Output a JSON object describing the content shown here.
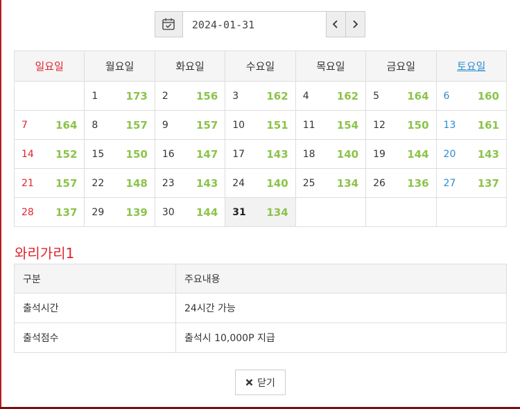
{
  "datepicker": {
    "value": "2024-01-31",
    "icon": "calendar-check-icon",
    "prev_icon": "chevron-left-icon",
    "next_icon": "chevron-right-icon"
  },
  "calendar": {
    "weekdays": [
      "일요일",
      "월요일",
      "화요일",
      "수요일",
      "목요일",
      "금요일",
      "토요일"
    ],
    "weeks": [
      [
        null,
        {
          "day": "1",
          "count": "173"
        },
        {
          "day": "2",
          "count": "156"
        },
        {
          "day": "3",
          "count": "162"
        },
        {
          "day": "4",
          "count": "162"
        },
        {
          "day": "5",
          "count": "164"
        },
        {
          "day": "6",
          "count": "160"
        }
      ],
      [
        {
          "day": "7",
          "count": "164"
        },
        {
          "day": "8",
          "count": "157"
        },
        {
          "day": "9",
          "count": "157"
        },
        {
          "day": "10",
          "count": "151"
        },
        {
          "day": "11",
          "count": "154"
        },
        {
          "day": "12",
          "count": "150"
        },
        {
          "day": "13",
          "count": "161"
        }
      ],
      [
        {
          "day": "14",
          "count": "152"
        },
        {
          "day": "15",
          "count": "150"
        },
        {
          "day": "16",
          "count": "147"
        },
        {
          "day": "17",
          "count": "143"
        },
        {
          "day": "18",
          "count": "140"
        },
        {
          "day": "19",
          "count": "144"
        },
        {
          "day": "20",
          "count": "143"
        }
      ],
      [
        {
          "day": "21",
          "count": "157"
        },
        {
          "day": "22",
          "count": "148"
        },
        {
          "day": "23",
          "count": "143"
        },
        {
          "day": "24",
          "count": "140"
        },
        {
          "day": "25",
          "count": "134"
        },
        {
          "day": "26",
          "count": "136"
        },
        {
          "day": "27",
          "count": "137"
        }
      ],
      [
        {
          "day": "28",
          "count": "137"
        },
        {
          "day": "29",
          "count": "139"
        },
        {
          "day": "30",
          "count": "144"
        },
        {
          "day": "31",
          "count": "134",
          "today": true
        },
        null,
        null,
        null
      ]
    ],
    "colors": {
      "sunday": "#e0242f",
      "saturday": "#2a8bd1",
      "count": "#8bc34a"
    }
  },
  "info": {
    "title": "와리가리1",
    "headers": [
      "구분",
      "주요내용"
    ],
    "rows": [
      [
        "출석시간",
        "24시간 가능"
      ],
      [
        "출석점수",
        "출석시 10,000P 지급"
      ]
    ]
  },
  "footer": {
    "close_label": "닫기",
    "close_icon": "close-icon"
  }
}
